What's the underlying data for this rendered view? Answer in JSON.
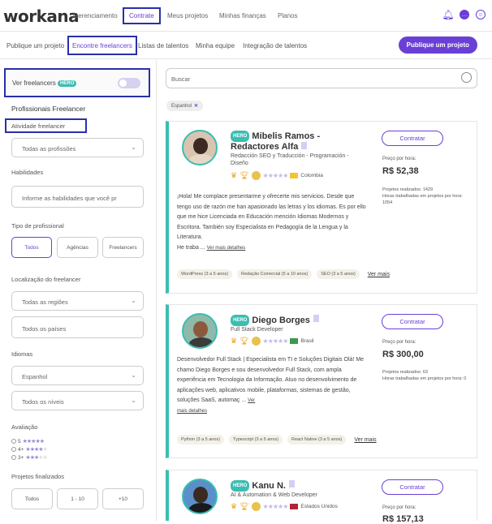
{
  "nav": {
    "logo": "workana",
    "items": [
      "Gerenciamento",
      "Contrate",
      "Meus projetos",
      "Minhas finanças",
      "Planos"
    ]
  },
  "subnav": {
    "items": [
      "Publique um projeto",
      "Encontre freelancers",
      "Listas de talentos",
      "Minha equipe",
      "Integração de talentos"
    ],
    "publish_button": "Publique um projeto"
  },
  "sidebar": {
    "hero_toggle_label": "Ver freelancers",
    "hero_badge": "HERO",
    "section_title": "Profissionais Freelancer",
    "activity_label": "Atividade freelancer",
    "activity_value": "Todas as profissões",
    "skills_label": "Habilidades",
    "skills_placeholder": "Informe as habilidades que você pr",
    "type_label": "Tipo de profissional",
    "type_buttons": [
      "Todos",
      "Agências",
      "Freelancers"
    ],
    "location_label": "Localização do freelancer",
    "region_value": "Todas as regiões",
    "country_placeholder": "Todos os países",
    "languages_label": "Idiomas",
    "language_value": "Espanhol",
    "level_value": "Todos os níveis",
    "rating_label": "Avaliação",
    "ratings": [
      "5",
      "4+",
      "3+"
    ],
    "projects_label": "Projetos finalizados",
    "projects_buttons": [
      "Todos",
      "1 - 10",
      "+10"
    ]
  },
  "search": {
    "placeholder": "Buscar",
    "chip": "Espanhol"
  },
  "freelancers": [
    {
      "hero": "HERO",
      "name": "Mibelis Ramos - Redactores Alfa",
      "title": "Redacción SEO y Traducción - Programación - Diseño",
      "country": "Colombia",
      "description": "¡Hola! Me complace presentarme y ofrecerte mis servicios. Desde que tengo uso de razón me han apasionado las letras y los idiomas. Es por ello que me hice Licenciada en Educación mención Idiomas Modernos y Escritora. También soy Especialista en Pedagogía de la Lengua y la Literatura.",
      "description_tail": "He traba ...",
      "more": "Ver mais detalhes",
      "skills": [
        "WordPress (3 a 5 anos)",
        "Redação Comercial (5 a 10 anos)",
        "SEO (3 a 5 anos)"
      ],
      "ver_mais": "Ver mais",
      "hire": "Contratar",
      "price_label": "Preço por hora:",
      "price": "R$ 52,38",
      "projects": "Projetos realizados: 1429",
      "hours": "Horas trabalhadas em projetos por hora: 1054"
    },
    {
      "hero": "HERO",
      "name": "Diego Borges",
      "title": "Full Stack Developer",
      "country": "Brasil",
      "description": "Desenvolvedor Full Stack | Especialista em TI e Soluções Digitais Olá! Me chamo Diego Borges e sou desenvolvedor Full Stack, com ampla experiência em Tecnologia da Informação. Atuo no desenvolvimento de aplicações web, aplicativos mobile, plataformas, sistemas de gestão, soluções SaaS, automaç ...",
      "more_inline": "Ver",
      "more": "mais detalhes",
      "skills": [
        "Python (3 a 5 anos)",
        "Typescript (3 a 5 anos)",
        "React Native (3 a 5 anos)"
      ],
      "ver_mais": "Ver mais",
      "hire": "Contratar",
      "price_label": "Preço por hora:",
      "price": "R$ 300,00",
      "projects": "Projetos realizados: 63",
      "hours": "Horas trabalhadas em projetos por hora: 0"
    },
    {
      "hero": "HERO",
      "name": "Kanu N.",
      "title": "AI & Automation & Web Developer",
      "country": "Estados Unidos",
      "hire": "Contratar",
      "price_label": "Preço por hora:",
      "price": "R$ 157,13"
    }
  ]
}
